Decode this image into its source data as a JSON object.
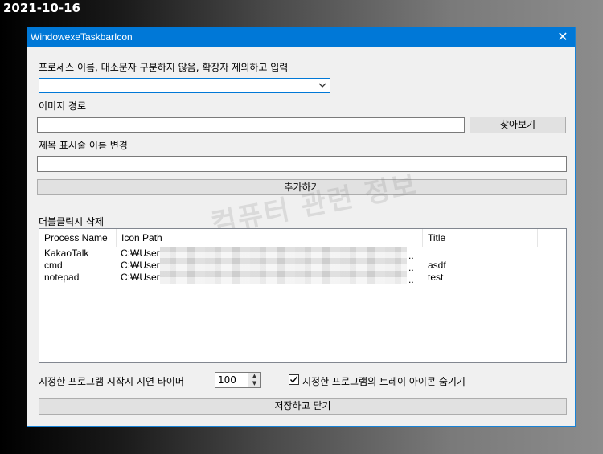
{
  "date_stamp": "2021-10-16",
  "window": {
    "title": "WindowexeTaskbarIcon",
    "close_glyph": "✕"
  },
  "form": {
    "process_label": "프로세스 이름, 대소문자 구분하지 않음, 확장자 제외하고 입력",
    "process_value": "",
    "image_path_label": "이미지 경로",
    "image_path_value": "",
    "browse_button": "찾아보기",
    "title_label": "제목 표시줄 이름 변경",
    "title_value": "",
    "add_button": "추가하기",
    "double_click_label": "더블클릭시 삭제"
  },
  "watermark": "컴퓨터 관련 정보",
  "list": {
    "columns": [
      "Process Name",
      "Icon Path",
      "Title"
    ],
    "rows": [
      {
        "process": "KakaoTalk",
        "path": "C:₩User",
        "path_tail": "..",
        "title": ""
      },
      {
        "process": "cmd",
        "path": "C:₩User",
        "path_tail": "..",
        "title": "asdf"
      },
      {
        "process": "notepad",
        "path": "C:₩User",
        "path_tail": "..",
        "title": "test"
      }
    ]
  },
  "footer": {
    "delay_label": "지정한 프로그램 시작시 지연 타이머",
    "delay_value": "100",
    "hide_tray_label": "지정한 프로그램의 트레이 아이콘 숨기기",
    "hide_tray_checked": true,
    "save_button": "저장하고 닫기"
  }
}
